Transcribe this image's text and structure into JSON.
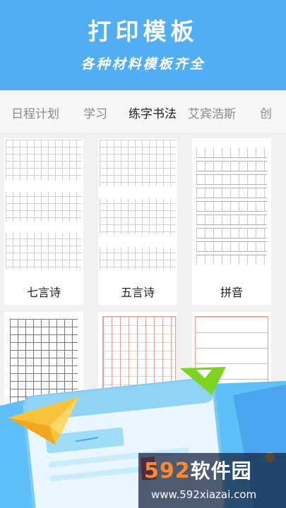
{
  "header": {
    "title": "打印模板",
    "subtitle": "各种材料模板齐全"
  },
  "tabs": [
    {
      "label": "日程计划",
      "active": false
    },
    {
      "label": "学习",
      "active": false
    },
    {
      "label": "练字书法",
      "active": true
    },
    {
      "label": "艾宾浩斯",
      "active": false
    },
    {
      "label": "创",
      "active": false
    }
  ],
  "templates": [
    {
      "label": "七言诗",
      "pattern": "tianzi-grid"
    },
    {
      "label": "五言诗",
      "pattern": "tianzi-grid"
    },
    {
      "label": "拼音",
      "pattern": "pinyin-grid"
    },
    {
      "label": "",
      "pattern": "square-grid"
    },
    {
      "label": "",
      "pattern": "red-columns"
    },
    {
      "label": "",
      "pattern": "red-lines"
    }
  ],
  "watermark": {
    "logo_digits": "592",
    "logo_text": "软件园",
    "url": "www.592xiazai.com"
  },
  "colors": {
    "header_bg": "#52aef2",
    "banner_blue": "#5bbcf5",
    "paper_plane": "#f7c13a",
    "accent_green": "#7ed321"
  }
}
